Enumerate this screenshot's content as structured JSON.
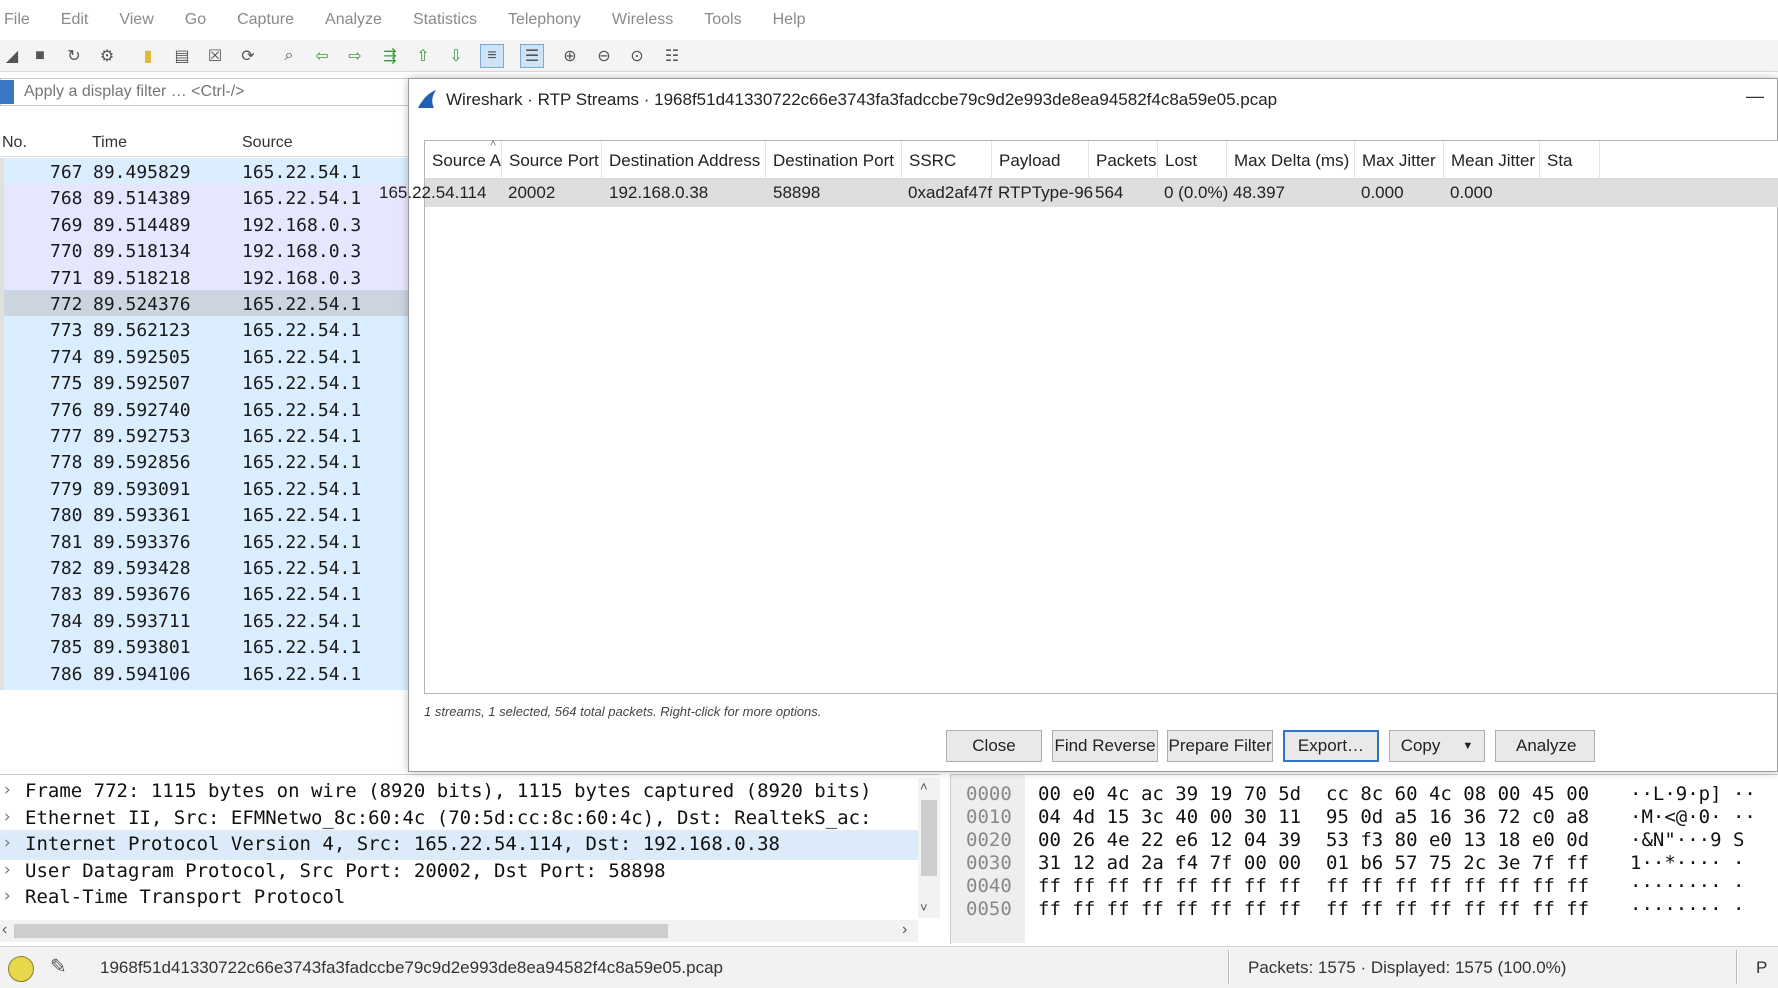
{
  "menu": [
    "File",
    "Edit",
    "View",
    "Go",
    "Capture",
    "Analyze",
    "Statistics",
    "Telephony",
    "Wireless",
    "Tools",
    "Help"
  ],
  "toolbar_icons": [
    "shark-fin-start-icon",
    "stop-icon",
    "restart-icon",
    "capture-options-icon",
    "open-folder-icon",
    "save-file-icon",
    "close-file-icon",
    "reload-icon",
    "find-icon",
    "go-back-icon",
    "go-forward-icon",
    "go-to-packet-icon",
    "first-packet-icon",
    "last-packet-icon",
    "auto-scroll-icon",
    "colorize-icon",
    "zoom-in-icon",
    "zoom-out-icon",
    "normal-size-icon",
    "resize-columns-icon"
  ],
  "filter": {
    "placeholder": "Apply a display filter … <Ctrl-/>"
  },
  "packet_list": {
    "columns": [
      "No.",
      "Time",
      "Source"
    ],
    "rows": [
      {
        "no": "767",
        "time": "89.495829",
        "source": "165.22.54.1"
      },
      {
        "no": "768",
        "time": "89.514389",
        "source": "165.22.54.1"
      },
      {
        "no": "769",
        "time": "89.514489",
        "source": "192.168.0.3"
      },
      {
        "no": "770",
        "time": "89.518134",
        "source": "192.168.0.3"
      },
      {
        "no": "771",
        "time": "89.518218",
        "source": "192.168.0.3"
      },
      {
        "no": "772",
        "time": "89.524376",
        "source": "165.22.54.1"
      },
      {
        "no": "773",
        "time": "89.562123",
        "source": "165.22.54.1"
      },
      {
        "no": "774",
        "time": "89.592505",
        "source": "165.22.54.1"
      },
      {
        "no": "775",
        "time": "89.592507",
        "source": "165.22.54.1"
      },
      {
        "no": "776",
        "time": "89.592740",
        "source": "165.22.54.1"
      },
      {
        "no": "777",
        "time": "89.592753",
        "source": "165.22.54.1"
      },
      {
        "no": "778",
        "time": "89.592856",
        "source": "165.22.54.1"
      },
      {
        "no": "779",
        "time": "89.593091",
        "source": "165.22.54.1"
      },
      {
        "no": "780",
        "time": "89.593361",
        "source": "165.22.54.1"
      },
      {
        "no": "781",
        "time": "89.593376",
        "source": "165.22.54.1"
      },
      {
        "no": "782",
        "time": "89.593428",
        "source": "165.22.54.1"
      },
      {
        "no": "783",
        "time": "89.593676",
        "source": "165.22.54.1"
      },
      {
        "no": "784",
        "time": "89.593711",
        "source": "165.22.54.1"
      },
      {
        "no": "785",
        "time": "89.593801",
        "source": "165.22.54.1"
      },
      {
        "no": "786",
        "time": "89.594106",
        "source": "165.22.54.1"
      }
    ],
    "colors": {
      "udp": "#daeeff",
      "local": "#e7e6ff",
      "selected": "#cbd4df"
    }
  },
  "packet_details": [
    "Frame 772: 1115 bytes on wire (8920 bits), 1115 bytes captured (8920 bits)",
    "Ethernet II, Src: EFMNetwo_8c:60:4c (70:5d:cc:8c:60:4c), Dst: RealtekS_ac:",
    "Internet Protocol Version 4, Src: 165.22.54.114, Dst: 192.168.0.38",
    "User Datagram Protocol, Src Port: 20002, Dst Port: 58898",
    "Real-Time Transport Protocol"
  ],
  "hex_dump": [
    {
      "offset": "0000",
      "bytes1": "00 e0 4c ac 39 19 70 5d",
      "bytes2": "cc 8c 60 4c 08 00 45 00",
      "ascii": "··L·9·p]  ··"
    },
    {
      "offset": "0010",
      "bytes1": "04 4d 15 3c 40 00 30 11",
      "bytes2": "95 0d a5 16 36 72 c0 a8",
      "ascii": "·M·<@·0·  ··"
    },
    {
      "offset": "0020",
      "bytes1": "00 26 4e 22 e6 12 04 39",
      "bytes2": "53 f3 80 e0 13 18 e0 0d",
      "ascii": "·&N\"···9 S"
    },
    {
      "offset": "0030",
      "bytes1": "31 12 ad 2a f4 7f 00 00",
      "bytes2": "01 b6 57 75 2c 3e 7f ff",
      "ascii": "1··*····  ·"
    },
    {
      "offset": "0040",
      "bytes1": "ff ff ff ff ff ff ff ff",
      "bytes2": "ff ff ff ff ff ff ff ff",
      "ascii": "········  ·"
    },
    {
      "offset": "0050",
      "bytes1": "ff ff ff ff ff ff ff ff",
      "bytes2": "ff ff ff ff ff ff ff ff",
      "ascii": "········  ·"
    }
  ],
  "status": {
    "file": "1968f51d41330722c66e3743fa3fadccbe79c9d2e993de8ea94582f4c8a59e05.pcap",
    "packets": "Packets: 1575 · Displayed: 1575 (100.0%)",
    "profile": "P"
  },
  "dialog": {
    "title": "Wireshark · RTP Streams · 1968f51d41330722c66e3743fa3fadccbe79c9d2e993de8ea94582f4c8a59e05.pcap",
    "minimize": "—",
    "columns": [
      "Source Address",
      "Source Port",
      "Destination Address",
      "Destination Port",
      "SSRC",
      "Payload",
      "Packets",
      "Lost",
      "Max Delta (ms)",
      "Max Jitter",
      "Mean Jitter",
      "Sta"
    ],
    "rows": [
      [
        "165.22.54.114",
        "20002",
        "192.168.0.38",
        "58898",
        "0xad2af47f",
        "RTPType-96",
        "564",
        "0 (0.0%)",
        "48.397",
        "0.000",
        "0.000",
        ""
      ]
    ],
    "hint": "1 streams, 1 selected, 564 total packets. Right-click for more options.",
    "buttons": {
      "close": "Close",
      "find_reverse": "Find Reverse",
      "prepare_filter": "Prepare Filter",
      "export": "Export…",
      "copy": "Copy",
      "analyze": "Analyze"
    }
  }
}
